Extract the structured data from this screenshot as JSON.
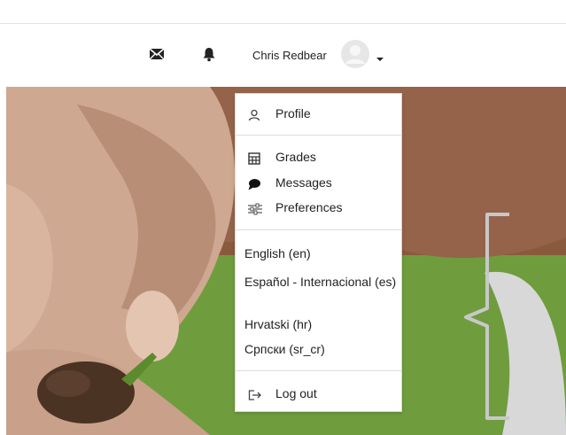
{
  "navbar": {
    "user_name": "Chris Redbear",
    "icons": [
      "envelope-icon",
      "bell-icon",
      "avatar-icon",
      "caret-down-icon"
    ]
  },
  "user_menu": {
    "items": [
      {
        "label": "Profile",
        "icon": "profile-icon"
      },
      {
        "label": "Grades",
        "icon": "grades-icon"
      },
      {
        "label": "Messages",
        "icon": "speech-bubble-icon"
      },
      {
        "label": "Preferences",
        "icon": "sliders-icon"
      }
    ],
    "languages": [
      "English ‎(en)‎",
      "Español - Internacional ‎(es)‎",
      "Hrvatski ‎(hr)‎",
      "Српски ‎(sr_cr)‎"
    ],
    "logout": {
      "label": "Log out",
      "icon": "logout-icon"
    }
  },
  "colors": {
    "navbar_bg": "#ffffff",
    "menu_border": "#d9d9d9",
    "grass": "#6f9d3e",
    "skin": "#d7b6a0",
    "soil": "#4a3322",
    "bracket": "#c8c8c8"
  }
}
